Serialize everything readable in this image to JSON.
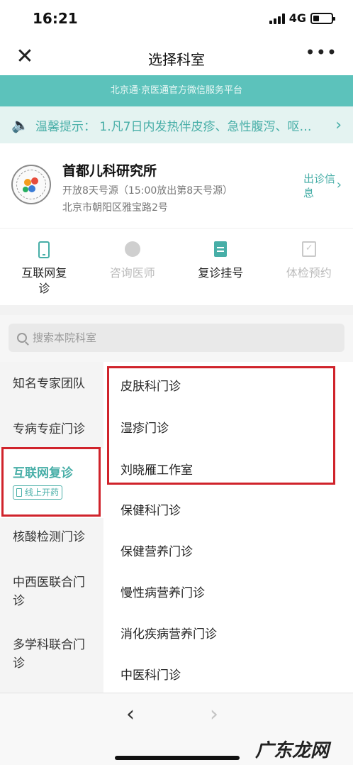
{
  "status_bar": {
    "time": "16:21",
    "network": "4G"
  },
  "nav": {
    "title": "选择科室",
    "close_icon": "close-icon",
    "more": "•••"
  },
  "banner": {
    "text": "北京通·京医通官方微信服务平台"
  },
  "notice": {
    "text": "温馨提示： 1.凡7日内发热伴皮疹、急性腹泻、呕…"
  },
  "hospital": {
    "name": "首都儿科研究所",
    "registration": "开放8天号源（15:00放出第8天号源）",
    "address": "北京市朝阳区雅宝路2号",
    "schedule_link": "出诊信息"
  },
  "services": [
    {
      "label": "互联网复诊",
      "icon": "phone-icon",
      "state": "active"
    },
    {
      "label": "咨询医师",
      "icon": "doctor-icon",
      "state": "disabled"
    },
    {
      "label": "复诊挂号",
      "icon": "document-icon",
      "state": "active"
    },
    {
      "label": "体检预约",
      "icon": "checklist-icon",
      "state": "disabled"
    }
  ],
  "search": {
    "placeholder": "搜索本院科室"
  },
  "categories": [
    {
      "label": "知名专家团队"
    },
    {
      "label": "专病专症门诊"
    },
    {
      "label": "互联网复诊",
      "badge": "线上开药",
      "active": true
    },
    {
      "label": "核酸检测门诊"
    },
    {
      "label": "中西医联合门诊"
    },
    {
      "label": "多学科联合门诊"
    }
  ],
  "departments": [
    "皮肤科门诊",
    "湿疹门诊",
    "刘晓雁工作室",
    "保健科门诊",
    "保健营养门诊",
    "慢性病营养门诊",
    "消化疾病营养门诊",
    "中医科门诊"
  ],
  "bottom_nav": {
    "back": "‹",
    "forward": "›"
  },
  "watermark": "广东龙网",
  "colors": {
    "accent": "#47aea7",
    "banner": "#5cc2bb",
    "highlight": "#d0232b"
  }
}
